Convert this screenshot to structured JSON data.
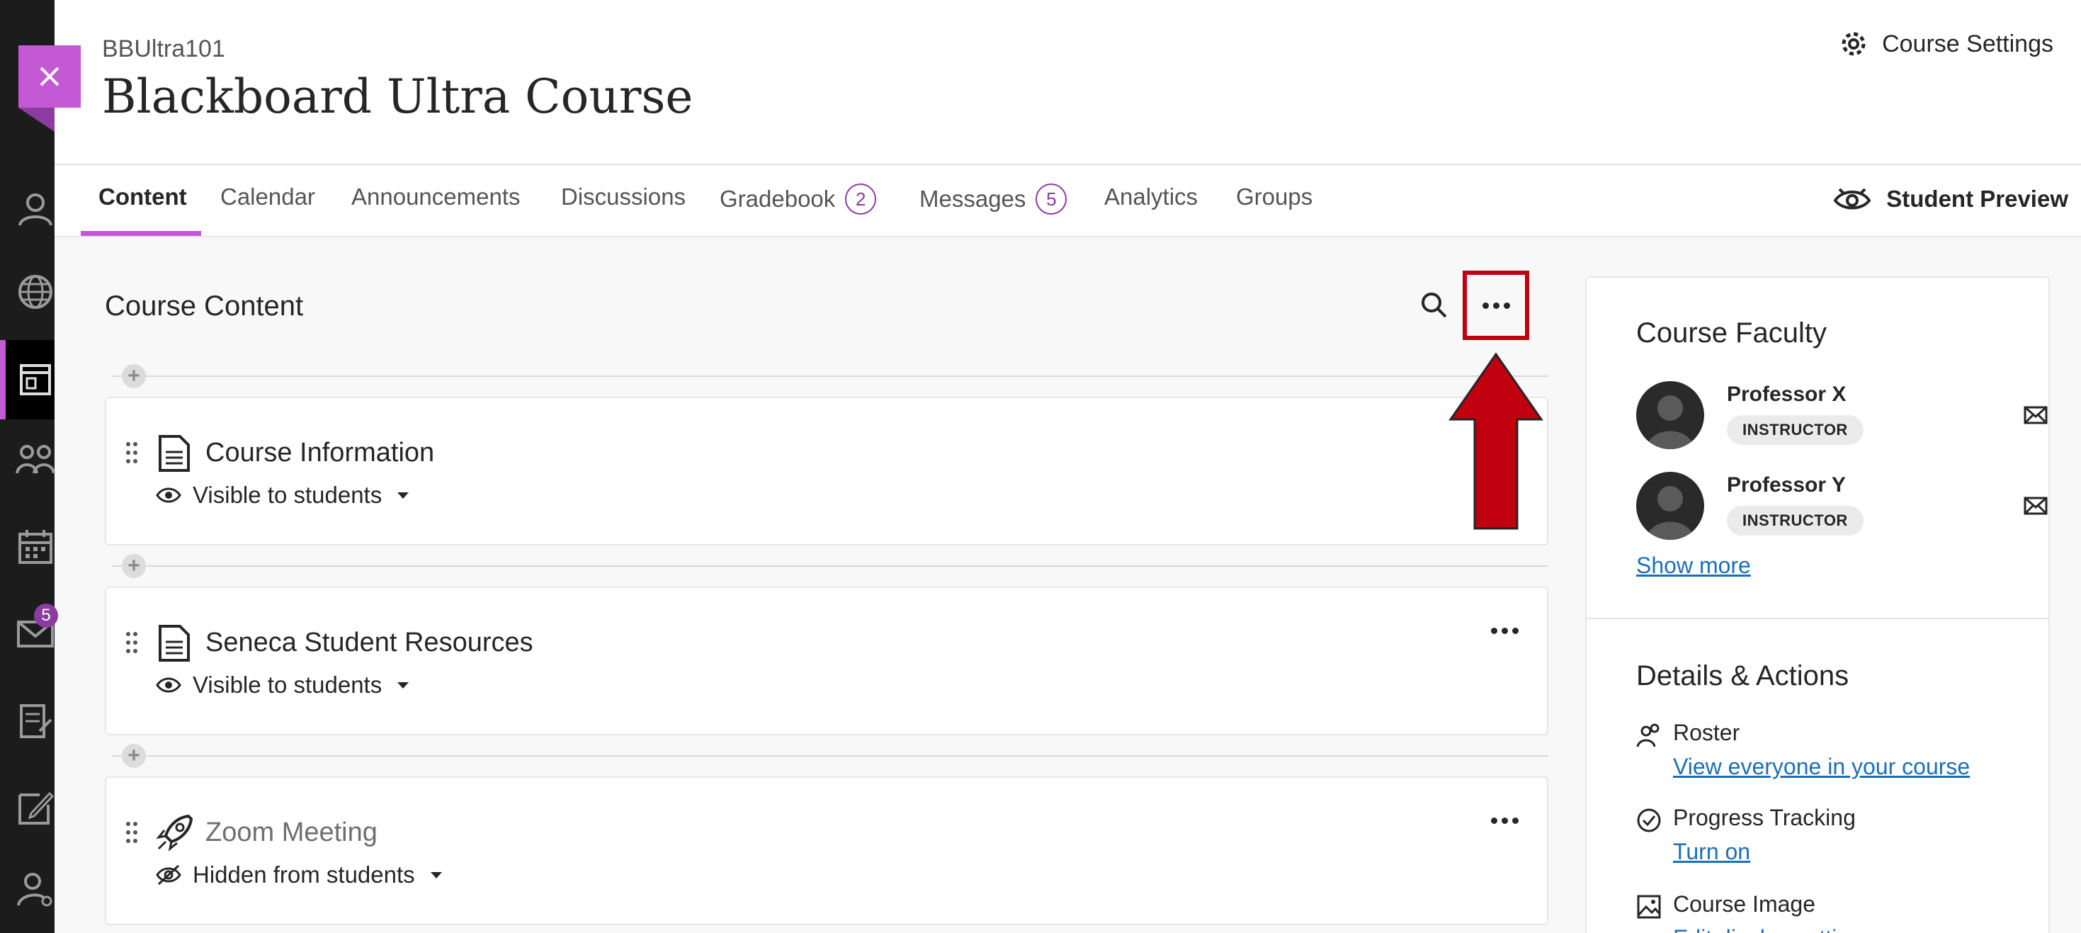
{
  "header": {
    "course_code": "BBUltra101",
    "course_title": "Blackboard Ultra Course",
    "settings_label": "Course Settings"
  },
  "leftnav": {
    "messages_badge": "5",
    "icons": [
      "profile-icon",
      "globe-icon",
      "courses-icon",
      "organizations-icon",
      "calendar-icon",
      "messages-icon",
      "grades-icon",
      "tools-icon",
      "admin-icon"
    ]
  },
  "tabs": [
    {
      "label": "Content",
      "active": true
    },
    {
      "label": "Calendar"
    },
    {
      "label": "Announcements"
    },
    {
      "label": "Discussions"
    },
    {
      "label": "Gradebook",
      "badge": "2"
    },
    {
      "label": "Messages",
      "badge": "5"
    },
    {
      "label": "Analytics"
    },
    {
      "label": "Groups"
    }
  ],
  "student_preview_label": "Student Preview",
  "content": {
    "title": "Course Content",
    "items": [
      {
        "title": "Course Information",
        "visibility": "Visible to students",
        "icon": "document-icon"
      },
      {
        "title": "Seneca Student Resources",
        "visibility": "Visible to students",
        "icon": "document-icon"
      },
      {
        "title": "Zoom Meeting",
        "visibility": "Hidden from students",
        "icon": "rocket-icon"
      }
    ]
  },
  "faculty": {
    "heading": "Course Faculty",
    "members": [
      {
        "name": "Professor X",
        "role": "INSTRUCTOR"
      },
      {
        "name": "Professor Y",
        "role": "INSTRUCTOR"
      }
    ],
    "show_more": "Show more"
  },
  "details": {
    "heading": "Details & Actions",
    "actions": [
      {
        "label": "Roster",
        "link": "View everyone in your course",
        "icon": "roster-icon"
      },
      {
        "label": "Progress Tracking",
        "link": "Turn on",
        "icon": "progress-check-icon"
      },
      {
        "label": "Course Image",
        "link": "Edit display settings",
        "icon": "image-icon"
      }
    ]
  },
  "colors": {
    "accent": "#c359d4",
    "badge": "#8c3b9e",
    "highlight_box": "#c0000f",
    "link": "#1d6fb5",
    "nav_bg": "#1c1c1c"
  }
}
